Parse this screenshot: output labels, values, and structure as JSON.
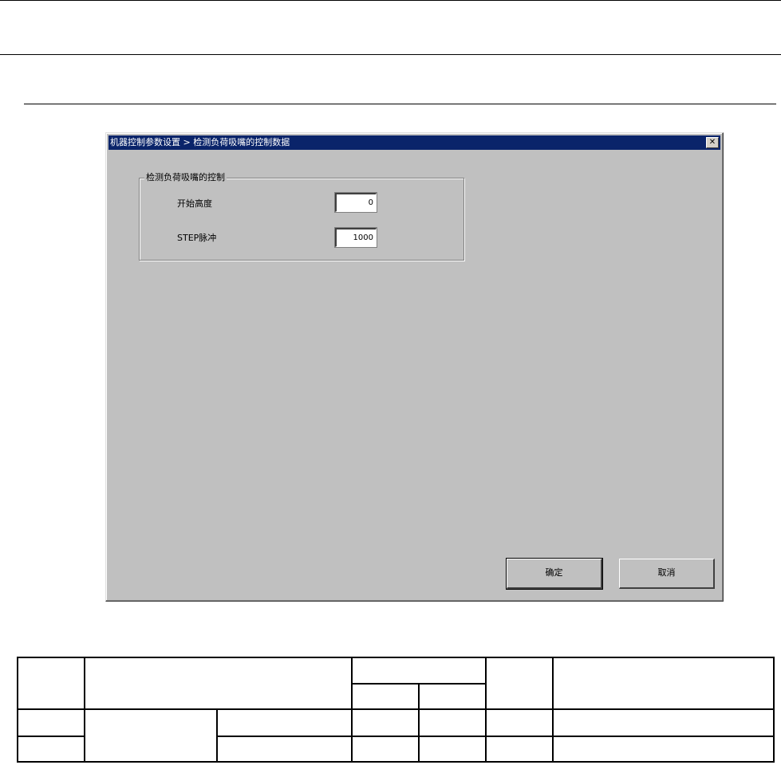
{
  "dialog": {
    "title": "机器控制参数设置 > 检测负荷吸嘴的控制数据",
    "close_glyph": "✕",
    "group": {
      "legend": "检测负荷吸嘴的控制",
      "fields": [
        {
          "label": "开始高度",
          "value": "0"
        },
        {
          "label": "STEP脉冲",
          "value": "1000"
        }
      ]
    },
    "buttons": {
      "ok": "确定",
      "cancel": "取消"
    }
  },
  "colors": {
    "dialog_bg": "#c0c0c0",
    "titlebar_bg": "#0a246a",
    "titlebar_text": "#ffffff"
  }
}
